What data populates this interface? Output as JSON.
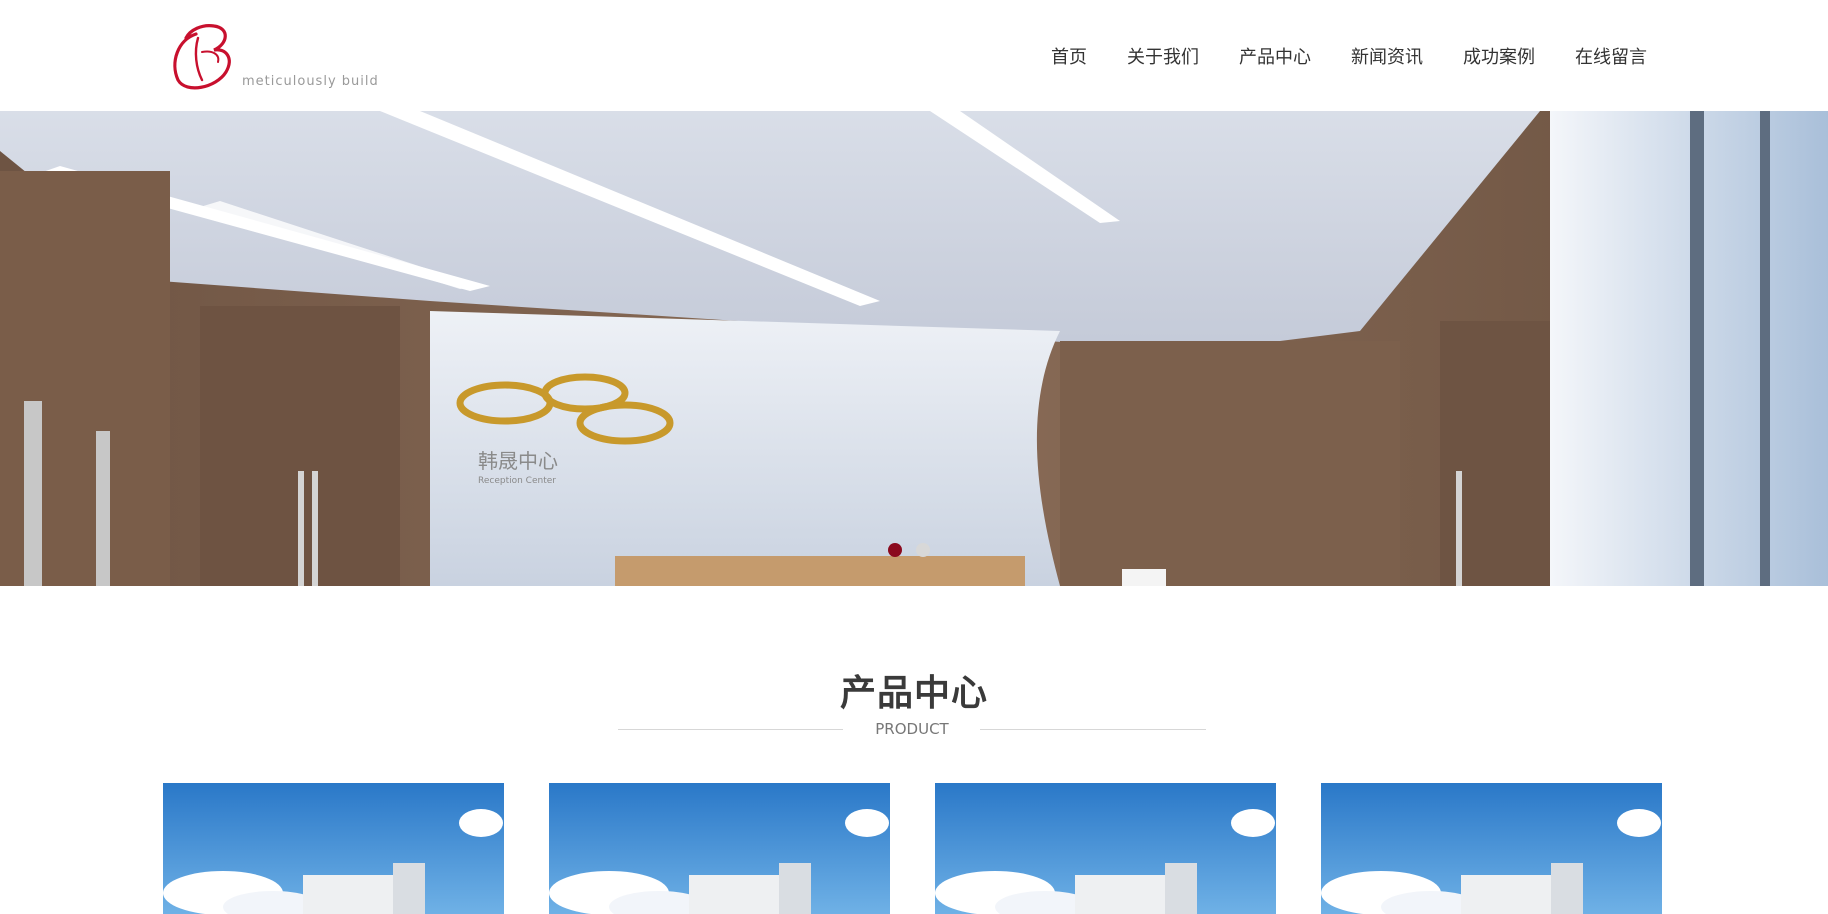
{
  "header": {
    "logo_text": "meticulously build",
    "nav": [
      "首页",
      "关于我们",
      "产品中心",
      "新闻资讯",
      "成功案例",
      "在线留言"
    ]
  },
  "banner": {
    "sign_text": "韩晟中心",
    "sign_sub": "Reception Center",
    "slides_count": 2,
    "active_slide": 1,
    "colors": {
      "dot_active": "#8b0a1e",
      "dot_inactive": "#d8d8d8"
    }
  },
  "section": {
    "title": "产品中心",
    "subtitle": "PRODUCT"
  },
  "products": [
    {
      "image": "building-photo"
    },
    {
      "image": "building-photo"
    },
    {
      "image": "building-photo"
    },
    {
      "image": "building-photo"
    }
  ],
  "colors": {
    "brand_red": "#c8102e"
  }
}
